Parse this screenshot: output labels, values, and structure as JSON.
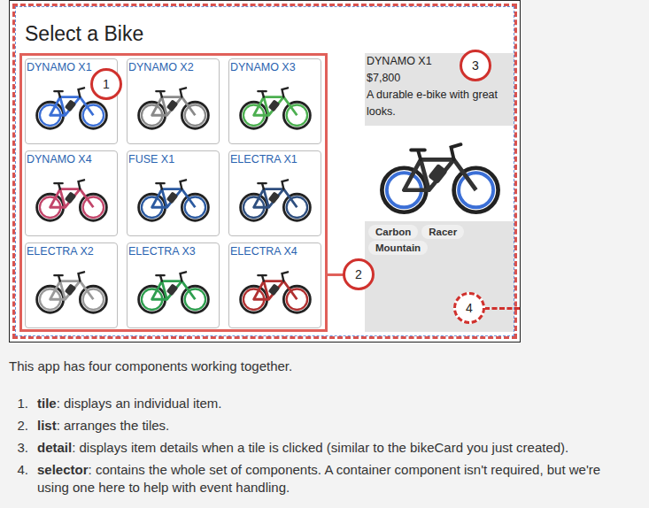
{
  "figure": {
    "title": "Select a Bike",
    "tiles": [
      {
        "name": "DYNAMO X1",
        "color": "#3b6fd6"
      },
      {
        "name": "DYNAMO X2",
        "color": "#8a8a8a"
      },
      {
        "name": "DYNAMO X3",
        "color": "#4caf50"
      },
      {
        "name": "DYNAMO X4",
        "color": "#c2456a"
      },
      {
        "name": "FUSE X1",
        "color": "#2c5aa0"
      },
      {
        "name": "ELECTRA X1",
        "color": "#2f4f7f"
      },
      {
        "name": "ELECTRA X2",
        "color": "#9a9a9a"
      },
      {
        "name": "ELECTRA X3",
        "color": "#2e9e4f"
      },
      {
        "name": "ELECTRA X4",
        "color": "#b03030"
      }
    ],
    "detail": {
      "name": "DYNAMO X1",
      "price": "$7,800",
      "description": "A durable e-bike with great looks.",
      "tags": [
        "Carbon",
        "Racer",
        "Mountain"
      ]
    },
    "callouts": {
      "tile": "1",
      "list": "2",
      "detail": "3",
      "selector": "4"
    }
  },
  "caption": "This app has four components working together.",
  "components": [
    {
      "number": "1.",
      "term": "tile",
      "text": ": displays an individual item."
    },
    {
      "number": "2.",
      "term": "list",
      "text": ": arranges the tiles."
    },
    {
      "number": "3.",
      "term": "detail",
      "text": ": displays item details when a tile is clicked (similar to the bikeCard you just created)."
    },
    {
      "number": "4.",
      "term": "selector",
      "text": ": contains the whole set of components. A container component isn't required, but we're using one here to help with event handling."
    }
  ]
}
